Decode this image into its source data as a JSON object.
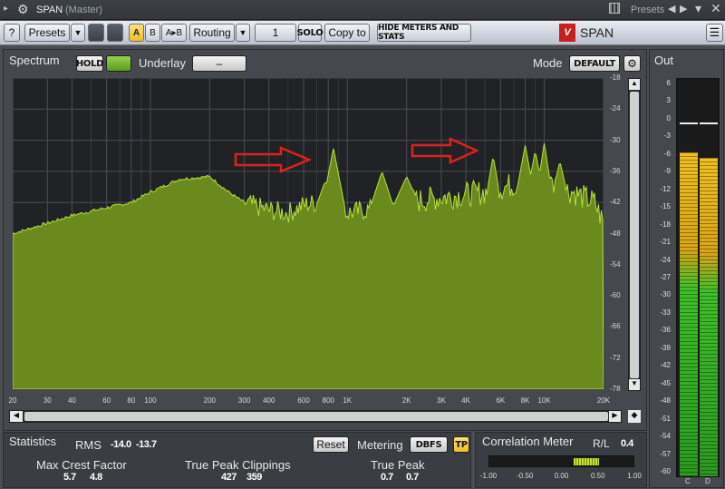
{
  "titlebar": {
    "plugin": "SPAN",
    "track": "(Master)",
    "presets_label": "Presets"
  },
  "toolbar": {
    "help": "?",
    "presets": "Presets",
    "a": "A",
    "b": "B",
    "ab": "A▸B",
    "routing": "Routing",
    "channel": "1",
    "solo": "SOLO",
    "copy_to": "Copy to",
    "hide_meters": "HIDE METERS AND STATS",
    "brand": "SPAN"
  },
  "spectrum": {
    "title": "Spectrum",
    "hold": "HOLD",
    "underlay_label": "Underlay",
    "underlay_value": "–",
    "mode_label": "Mode",
    "mode_value": "DEFAULT",
    "y_ticks": [
      "-18",
      "-24",
      "-30",
      "-36",
      "-42",
      "-48",
      "-54",
      "-60",
      "-66",
      "-72",
      "-78"
    ],
    "x_ticks": [
      "20",
      "30",
      "40",
      "60",
      "80",
      "100",
      "200",
      "300",
      "400",
      "600",
      "800",
      "1K",
      "2K",
      "3K",
      "4K",
      "6K",
      "8K",
      "10K",
      "20K"
    ]
  },
  "out": {
    "title": "Out",
    "scale": [
      "6",
      "3",
      "0",
      "-3",
      "-6",
      "-9",
      "-12",
      "-15",
      "-18",
      "-21",
      "-24",
      "-27",
      "-30",
      "-33",
      "-36",
      "-39",
      "-42",
      "-45",
      "-48",
      "-51",
      "-54",
      "-57",
      "-60"
    ],
    "channels": [
      "C",
      "D"
    ],
    "levels_db": [
      -5.5,
      -6.5
    ],
    "peaks_db": [
      -0.5,
      -0.5
    ]
  },
  "statistics": {
    "title": "Statistics",
    "rms_label": "RMS",
    "rms_l": "-14.0",
    "rms_r": "-13.7",
    "reset": "Reset",
    "metering_label": "Metering",
    "metering_value": "DBFS",
    "tp": "TP",
    "crest_label": "Max Crest Factor",
    "crest_l": "5.7",
    "crest_r": "4.8",
    "clip_label": "True Peak Clippings",
    "clip_l": "427",
    "clip_r": "359",
    "tp_label": "True Peak",
    "tp_l": "0.7",
    "tp_r": "0.7"
  },
  "correlation": {
    "title": "Correlation Meter",
    "rl_label": "R/L",
    "rl_value": "0.4",
    "scale": [
      "-1.00",
      "-0.50",
      "0.00",
      "0.50",
      "1.00"
    ],
    "value": 0.4
  },
  "colors": {
    "spectrum_fill": "#6a8a1e",
    "spectrum_line": "#b8e03a",
    "meter_yellow": "#f0c020",
    "meter_green": "#3fbf2a"
  }
}
